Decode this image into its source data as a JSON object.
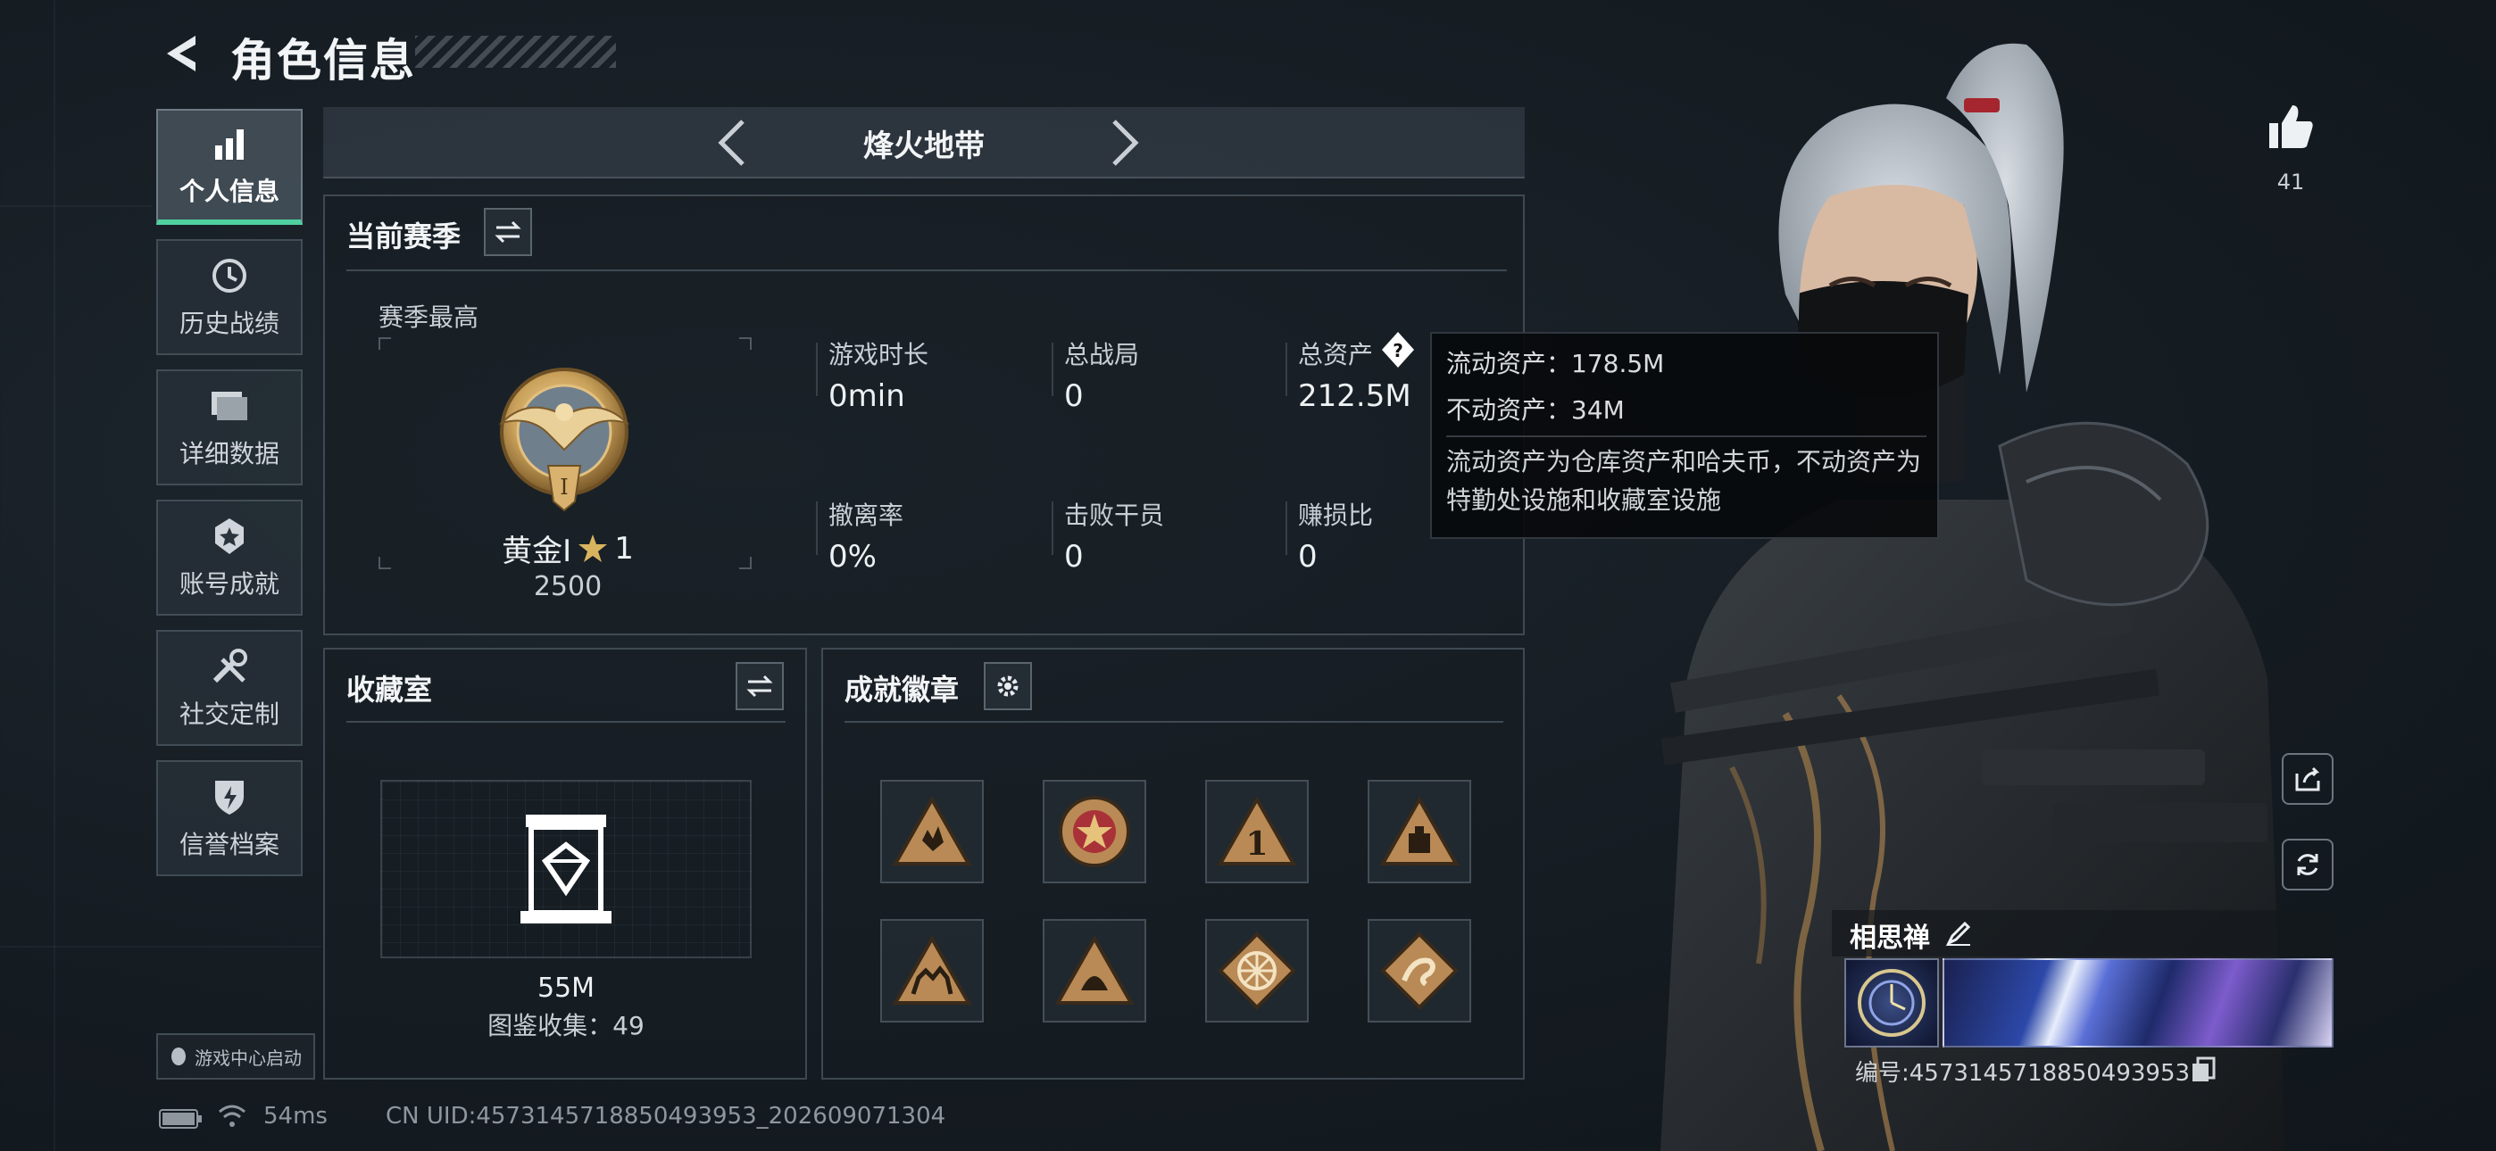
{
  "header": {
    "title": "角色信息"
  },
  "sidebar": {
    "items": [
      {
        "label": "个人信息",
        "icon": "bar-chart-icon",
        "active": true
      },
      {
        "label": "历史战绩",
        "icon": "history-icon"
      },
      {
        "label": "详细数据",
        "icon": "folder-icon"
      },
      {
        "label": "账号成就",
        "icon": "achievement-icon"
      },
      {
        "label": "社交定制",
        "icon": "tools-icon"
      },
      {
        "label": "信誉档案",
        "icon": "shield-icon"
      }
    ],
    "game_center": "游戏中心启动"
  },
  "mode": {
    "title": "烽火地带"
  },
  "season": {
    "title": "当前赛季",
    "best_label": "赛季最高",
    "rank_name": "黄金Ⅰ",
    "rank_stars": "1",
    "rank_score": "2500",
    "rank_numeral": "I",
    "stats": [
      {
        "label": "游戏时长",
        "value": "0min"
      },
      {
        "label": "总战局",
        "value": "0"
      },
      {
        "label": "总资产",
        "value": "212.5M"
      },
      {
        "label": "撤离率",
        "value": "0%"
      },
      {
        "label": "击败干员",
        "value": "0"
      },
      {
        "label": "赚损比",
        "value": "0"
      }
    ]
  },
  "tooltip": {
    "liquid": "流动资产：178.5M",
    "fixed": "不动资产：34M",
    "desc": "流动资产为仓库资产和哈夫币，不动资产为特勤处设施和收藏室设施"
  },
  "collection": {
    "title": "收藏室",
    "value": "55M",
    "count": "图鉴收集：49"
  },
  "badges": {
    "title": "成就徽章",
    "items": [
      "hand-sign-badge",
      "star-medal-badge",
      "number-one-badge",
      "box-badge",
      "camel-badge",
      "helmet-badge",
      "wheel-badge",
      "snake-badge"
    ]
  },
  "profile": {
    "likes": "41",
    "name": "相思禅",
    "id": "编号:4573145718850493953"
  },
  "footer": {
    "ping": "54ms",
    "uid": "CN UID:4573145718850493953_202609071304"
  },
  "colors": {
    "accent": "#4fd1a0",
    "gold": "#c9a15a",
    "badge_bronze": "#b98a55"
  }
}
